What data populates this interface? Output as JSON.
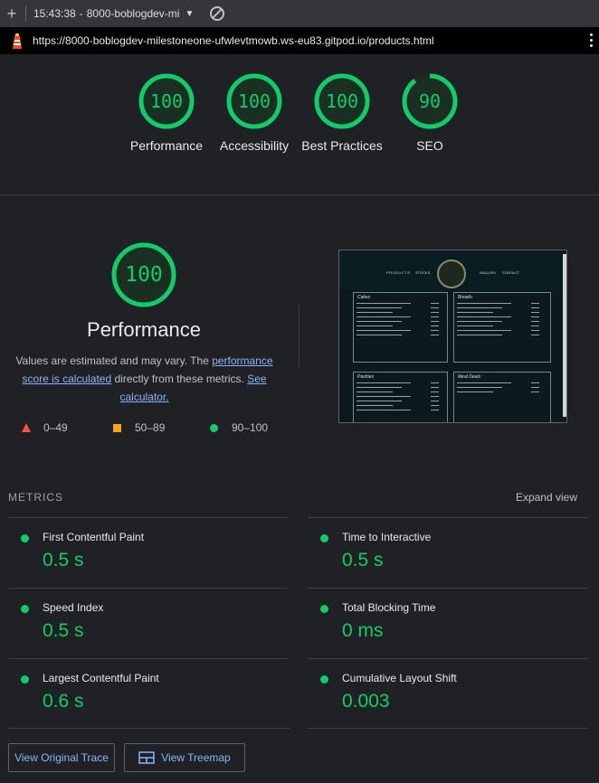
{
  "browser": {
    "tab_time": "15:43:38",
    "tab_title": "8000-boblogdev-mi",
    "url": "https://8000-boblogdev-milestoneone-ufwlevtmowb.ws-eu83.gitpod.io/products.html"
  },
  "scores": [
    {
      "label": "Performance",
      "value": "100",
      "fraction": 1.0
    },
    {
      "label": "Accessibility",
      "value": "100",
      "fraction": 1.0
    },
    {
      "label": "Best Practices",
      "value": "100",
      "fraction": 1.0
    },
    {
      "label": "SEO",
      "value": "90",
      "fraction": 0.9
    }
  ],
  "performance": {
    "score": "100",
    "title": "Performance",
    "desc_1": "Values are estimated and may vary. The ",
    "desc_link_1": "performance score is calculated",
    "desc_2": " directly from these metrics. ",
    "desc_link_2": "See calculator."
  },
  "legend": [
    {
      "range": "0–49",
      "color": "#ff4e42"
    },
    {
      "range": "50–89",
      "color": "#ffa400"
    },
    {
      "range": "90–100",
      "color": "#0cce6b"
    }
  ],
  "preview": {
    "nav": [
      "PRODUCTS",
      "STOCKS",
      "GALLERY",
      "CONTACT"
    ],
    "cards": [
      "Cakes",
      "Breads",
      "Pastries",
      "Meal Deals"
    ]
  },
  "metrics": {
    "heading": "METRICS",
    "expand_label": "Expand view",
    "items": [
      {
        "title": "First Contentful Paint",
        "value": "0.5 s"
      },
      {
        "title": "Time to Interactive",
        "value": "0.5 s"
      },
      {
        "title": "Speed Index",
        "value": "0.5 s"
      },
      {
        "title": "Total Blocking Time",
        "value": "0 ms"
      },
      {
        "title": "Largest Contentful Paint",
        "value": "0.6 s"
      },
      {
        "title": "Cumulative Layout Shift",
        "value": "0.003"
      }
    ]
  },
  "buttons": {
    "original_trace": "View Original Trace",
    "treemap": "View Treemap"
  },
  "colors": {
    "pass": "#0cce6b",
    "link": "#8ab4f8",
    "background": "#202124"
  }
}
